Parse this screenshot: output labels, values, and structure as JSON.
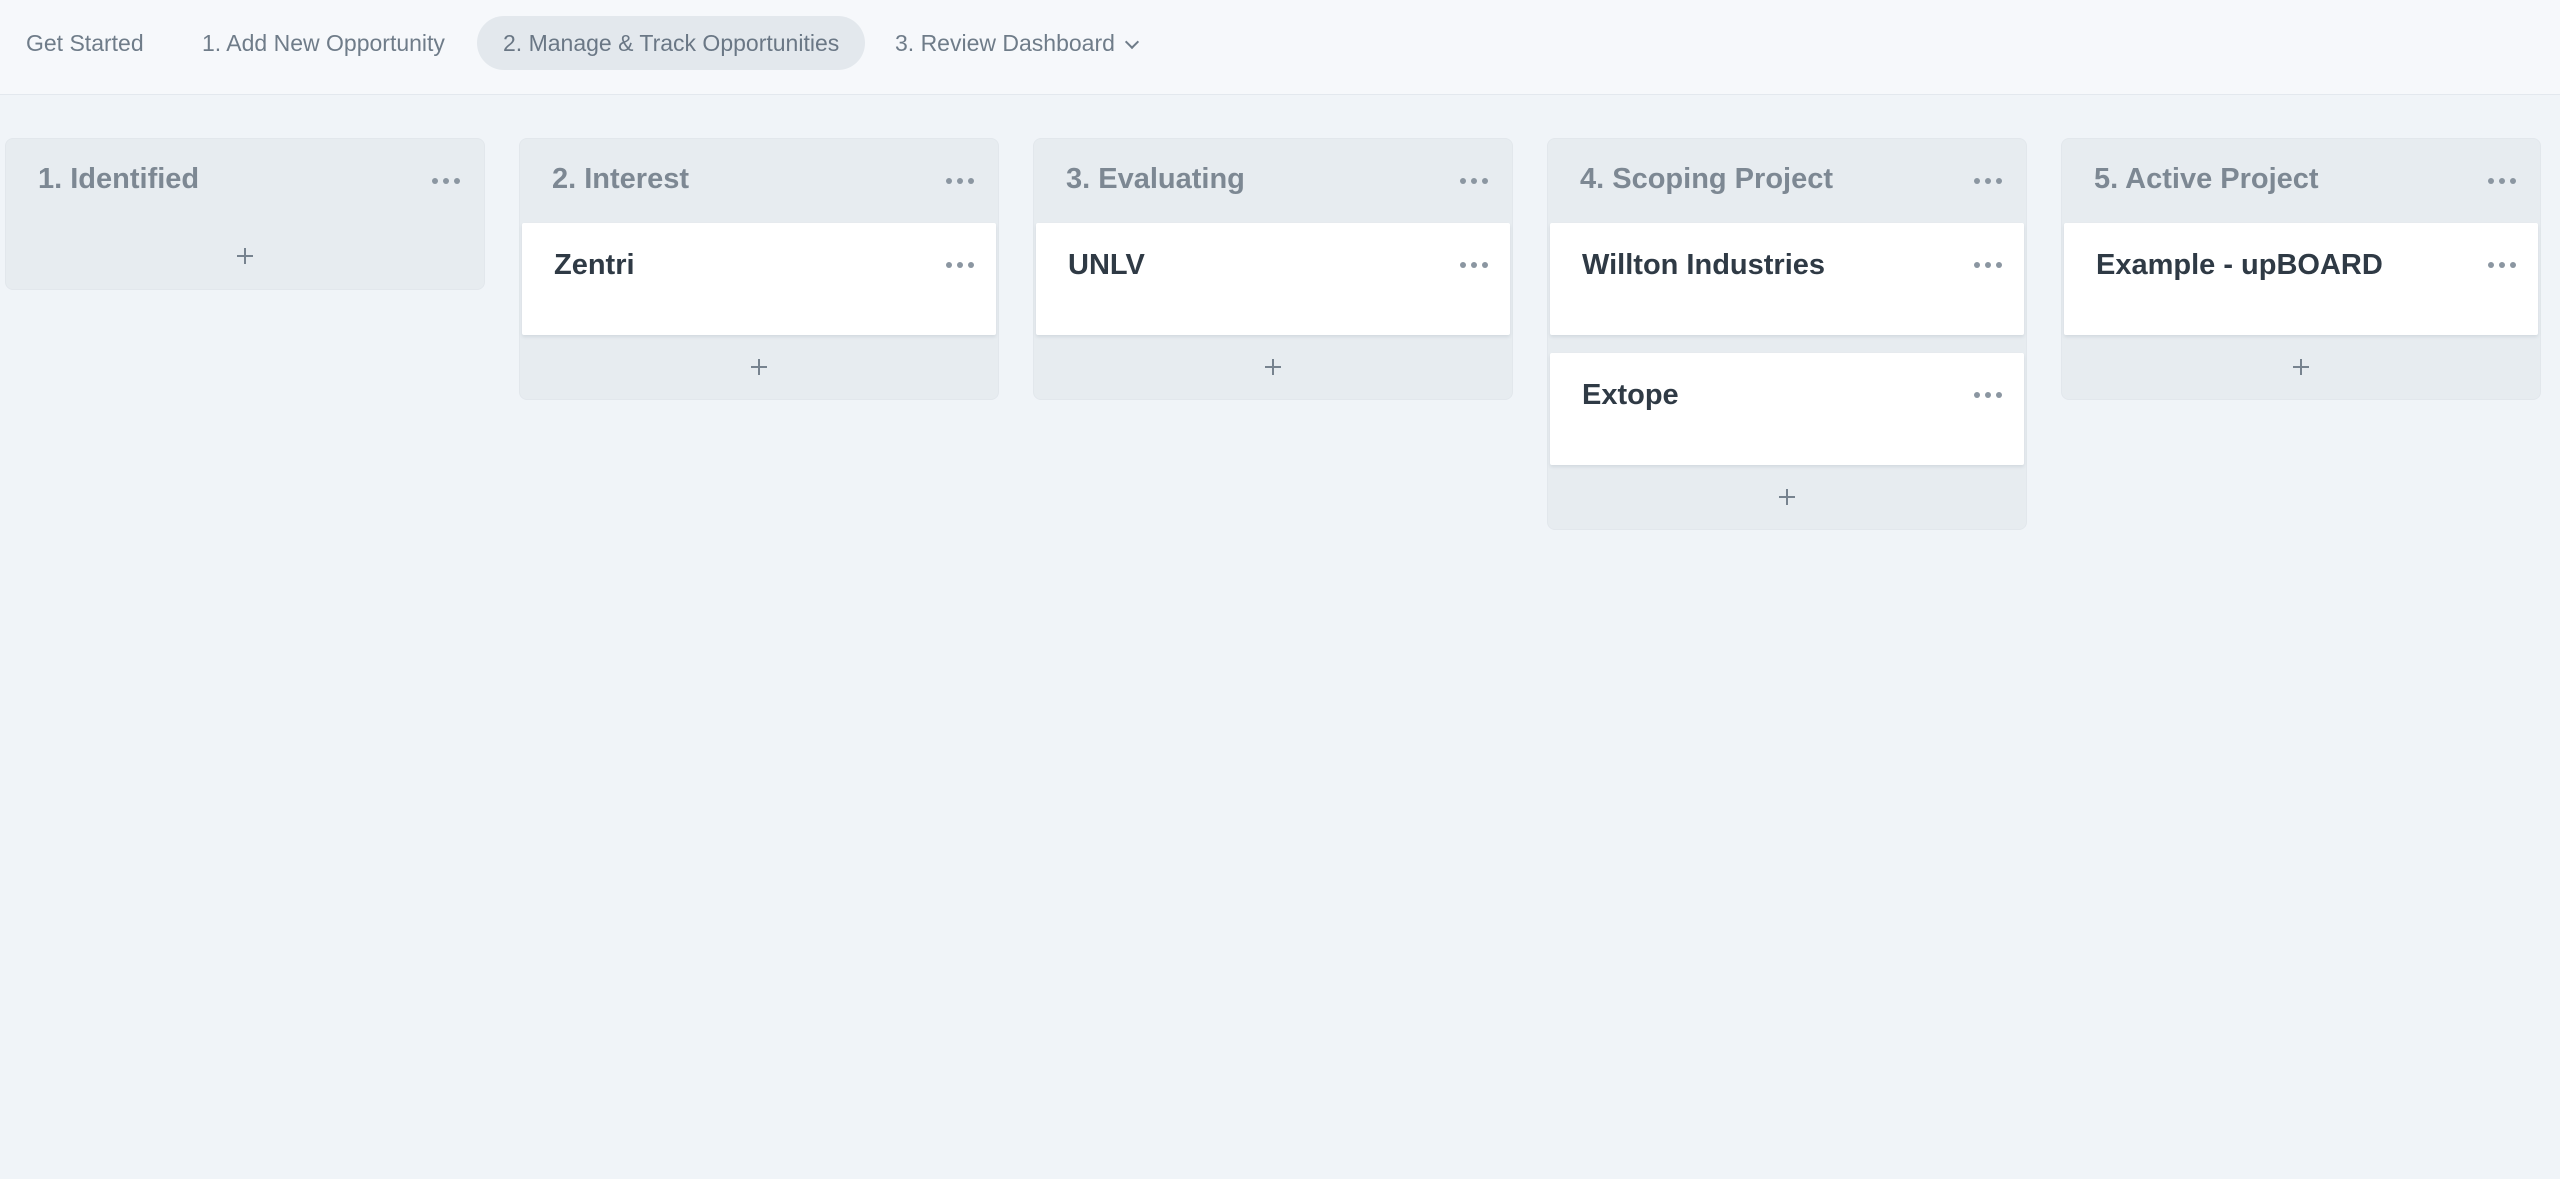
{
  "nav": {
    "tabs": [
      {
        "label": "Get Started"
      },
      {
        "label": "1. Add New Opportunity"
      },
      {
        "label": "2. Manage & Track Opportunities"
      },
      {
        "label": "3. Review Dashboard"
      }
    ],
    "active_tab": "2. Manage & Track Opportunities"
  },
  "board": {
    "columns": [
      {
        "title": "1. Identified",
        "cards": []
      },
      {
        "title": "2. Interest",
        "cards": [
          {
            "title": "Zentri"
          }
        ]
      },
      {
        "title": "3. Evaluating",
        "cards": [
          {
            "title": "UNLV"
          }
        ]
      },
      {
        "title": "4. Scoping Project",
        "cards": [
          {
            "title": "Willton Industries"
          },
          {
            "title": "Extope"
          }
        ]
      },
      {
        "title": "5. Active Project",
        "cards": [
          {
            "title": "Example - upBOARD"
          }
        ]
      }
    ]
  },
  "icons": {
    "column_menu": "more-horizontal-icon",
    "card_menu": "more-horizontal-icon",
    "add_card": "plus-icon",
    "dropdown": "chevron-down-icon"
  },
  "colors": {
    "background": "#f0f4f8",
    "column_bg": "#e7ecf0",
    "card_bg": "#ffffff",
    "active_tab_bg": "#e3e8ed"
  }
}
